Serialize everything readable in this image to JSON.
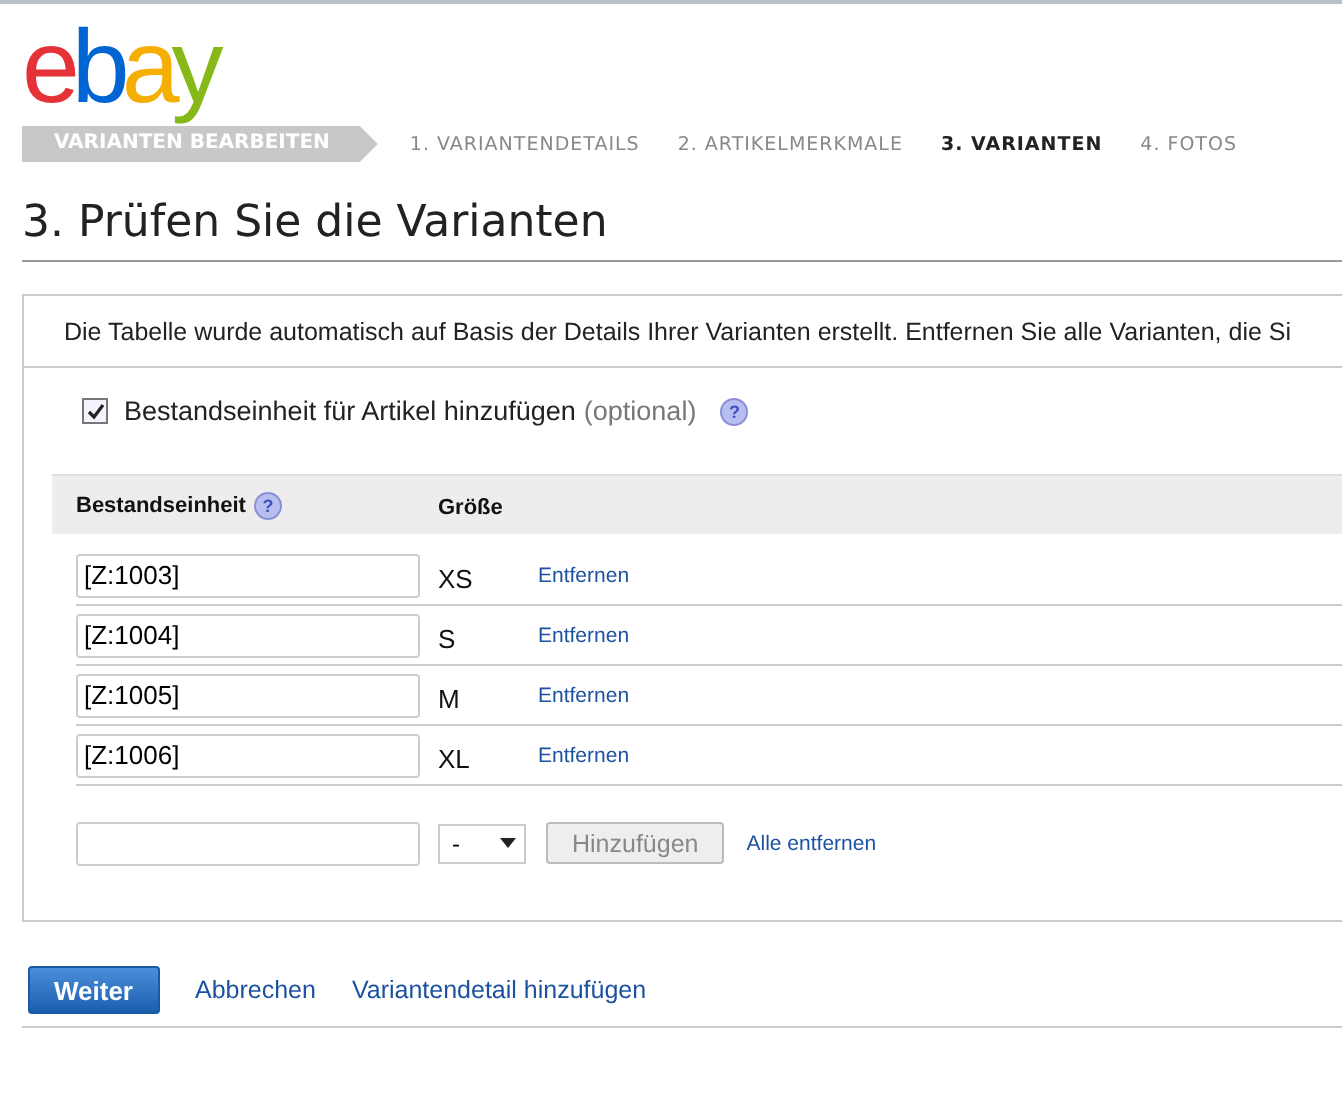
{
  "logo": {
    "text": "ebay"
  },
  "stepper": {
    "title": "VARIANTEN BEARBEITEN",
    "steps": [
      {
        "label": "1. VARIANTENDETAILS",
        "selected": false
      },
      {
        "label": "2. ARTIKELMERKMALE",
        "selected": false
      },
      {
        "label": "3. VARIANTEN",
        "selected": true
      },
      {
        "label": "4. FOTOS",
        "selected": false
      }
    ]
  },
  "heading": "3. Prüfen Sie die Varianten",
  "description": "Die Tabelle wurde automatisch auf Basis der Details Ihrer Varianten erstellt. Entfernen Sie alle Varianten, die Si",
  "sku_option": {
    "label": "Bestandseinheit für Artikel hinzufügen",
    "note": "(optional)",
    "help_icon": "?",
    "checked": true
  },
  "table": {
    "columns": [
      "Bestandseinheit",
      "Größe"
    ],
    "column_help_icon": "?",
    "rows": [
      {
        "sku": "[Z:1003]",
        "size": "XS",
        "action": "Entfernen"
      },
      {
        "sku": "[Z:1004]",
        "size": "S",
        "action": "Entfernen"
      },
      {
        "sku": "[Z:1005]",
        "size": "M",
        "action": "Entfernen"
      },
      {
        "sku": "[Z:1006]",
        "size": "XL",
        "action": "Entfernen"
      }
    ],
    "new_row": {
      "size": "-",
      "add_button": "Hinzufügen",
      "remove_all": "Alle entfernen"
    }
  },
  "footer": {
    "primary": "Weiter",
    "cancel": "Abbrechen",
    "add_detail": "Variantendetail hinzufügen"
  }
}
